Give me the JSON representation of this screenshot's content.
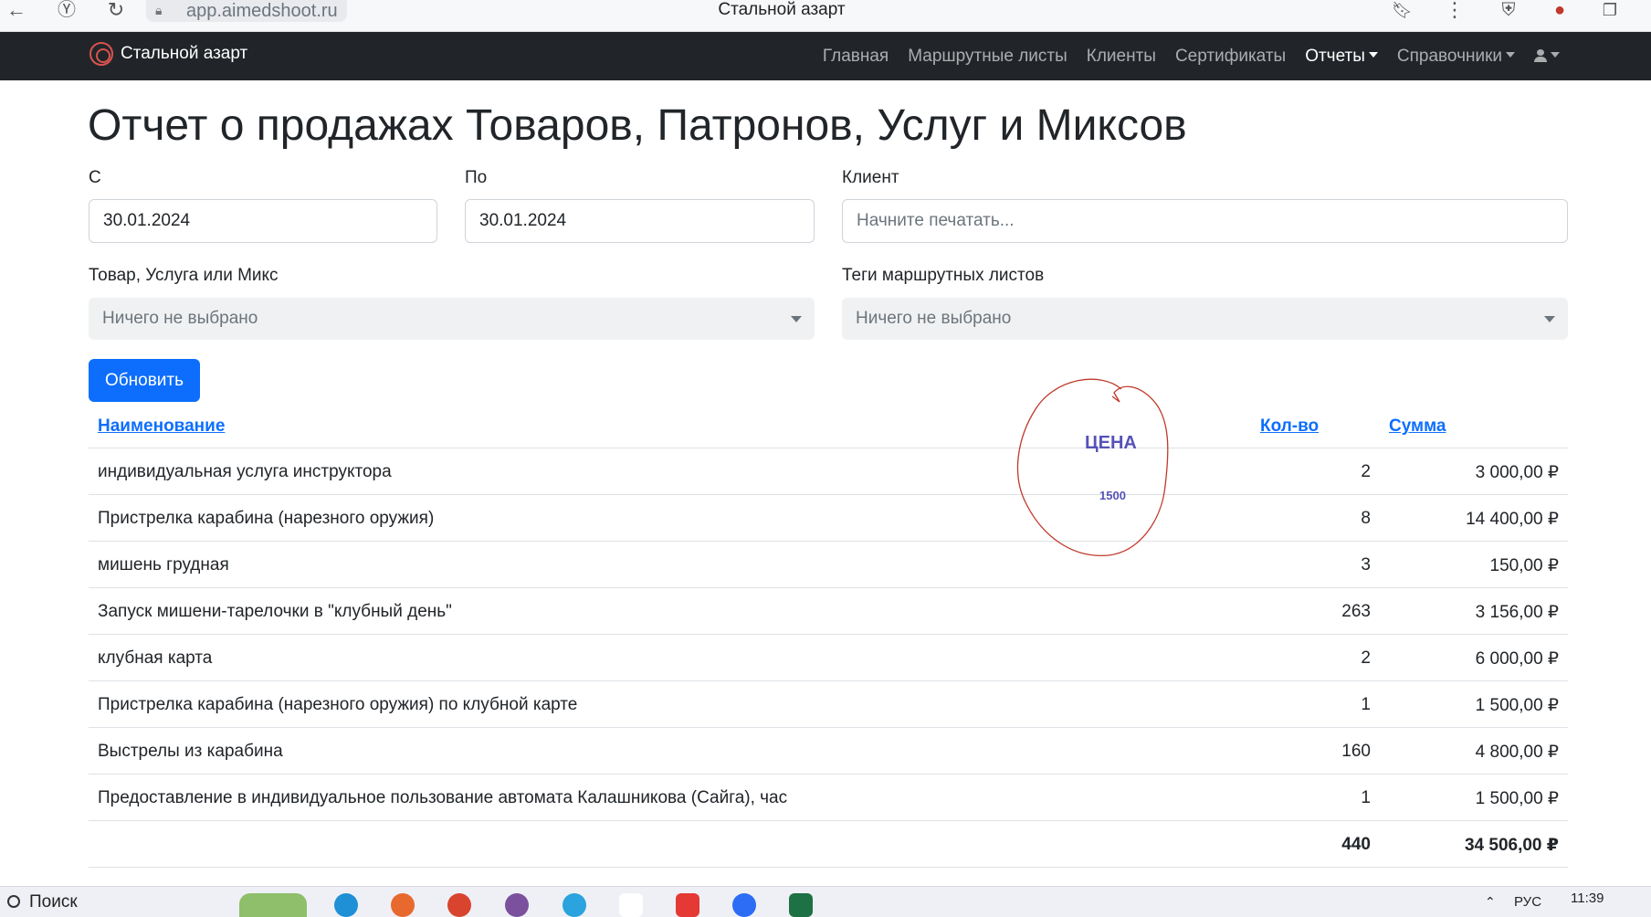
{
  "browser": {
    "url": "app.aimedshoot.ru",
    "tab_title": "Стальной азарт"
  },
  "navbar": {
    "brand": "Стальной азарт",
    "items": [
      {
        "label": "Главная"
      },
      {
        "label": "Маршрутные листы"
      },
      {
        "label": "Клиенты"
      },
      {
        "label": "Сертификаты"
      },
      {
        "label": "Отчеты"
      },
      {
        "label": "Справочники"
      }
    ]
  },
  "page": {
    "title": "Отчет о продажах Товаров, Патронов, Услуг и Миксов"
  },
  "filters": {
    "from_label": "С",
    "from_value": "30.01.2024",
    "to_label": "По",
    "to_value": "30.01.2024",
    "client_label": "Клиент",
    "client_placeholder": "Начните печатать...",
    "item_label": "Товар, Услуга или Микс",
    "item_value": "Ничего не выбрано",
    "tags_label": "Теги маршрутных листов",
    "tags_value": "Ничего не выбрано",
    "refresh_label": "Обновить"
  },
  "table": {
    "headers": {
      "name": "Наименование",
      "qty": "Кол-во",
      "sum": "Сумма"
    },
    "rows": [
      {
        "name": "индивидуальная услуга инструктора",
        "qty": "2",
        "sum": "3 000,00 ₽"
      },
      {
        "name": "Пристрелка карабина (нарезного оружия)",
        "qty": "8",
        "sum": "14 400,00 ₽"
      },
      {
        "name": "мишень грудная",
        "qty": "3",
        "sum": "150,00 ₽"
      },
      {
        "name": "Запуск мишени-тарелочки в \"клубный день\"",
        "qty": "263",
        "sum": "3 156,00 ₽"
      },
      {
        "name": "клубная карта",
        "qty": "2",
        "sum": "6 000,00 ₽"
      },
      {
        "name": "Пристрелка карабина (нарезного оружия) по клубной карте",
        "qty": "1",
        "sum": "1 500,00 ₽"
      },
      {
        "name": "Выстрелы из карабина",
        "qty": "160",
        "sum": "4 800,00 ₽"
      },
      {
        "name": "Предоставление в индивидуальное пользование автомата Калашникова (Сайга), час",
        "qty": "1",
        "sum": "1 500,00 ₽"
      }
    ],
    "total": {
      "qty": "440",
      "sum": "34 506,00 ₽"
    }
  },
  "annotation": {
    "title": "ЦЕНА",
    "value": "1500",
    "color": "#c0392b"
  },
  "taskbar": {
    "search_label": "Поиск",
    "lang": "РУС",
    "time": "11:39"
  },
  "colors": {
    "navbar": "#212529",
    "primary": "#0d6efd"
  }
}
